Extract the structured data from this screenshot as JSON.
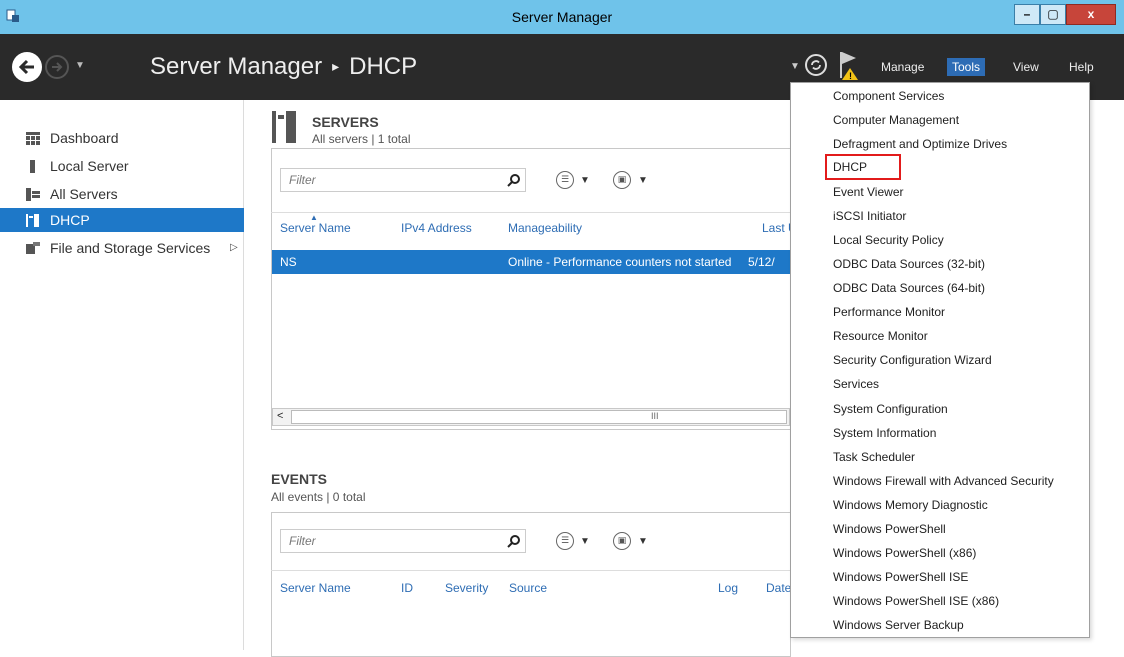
{
  "window": {
    "title": "Server Manager",
    "min_label": "▁",
    "max_label": "▢",
    "close_label": "x"
  },
  "header": {
    "breadcrumb_app": "Server Manager",
    "breadcrumb_sep": "▸",
    "breadcrumb_page": "DHCP",
    "menus": {
      "manage": "Manage",
      "tools": "Tools",
      "view": "View",
      "help": "Help"
    }
  },
  "sidebar": {
    "items": [
      {
        "label": "Dashboard",
        "icon": "dashboard-icon"
      },
      {
        "label": "Local Server",
        "icon": "server-icon"
      },
      {
        "label": "All Servers",
        "icon": "servers-icon"
      },
      {
        "label": "DHCP",
        "icon": "dhcp-icon",
        "active": true
      },
      {
        "label": "File and Storage Services",
        "icon": "storage-icon",
        "arrow": "▷"
      }
    ]
  },
  "servers": {
    "title": "SERVERS",
    "subtitle": "All servers | 1 total",
    "filter_placeholder": "Filter",
    "columns": [
      "Server Name",
      "IPv4 Address",
      "Manageability",
      "Last U"
    ],
    "rows": [
      {
        "name": "NS",
        "ipv4": "",
        "manageability": "Online - Performance counters not started",
        "last": "5/12/"
      }
    ],
    "scroll_mid": "III",
    "scroll_left": "<"
  },
  "events": {
    "title": "EVENTS",
    "subtitle": "All events | 0 total",
    "filter_placeholder": "Filter",
    "columns": [
      "Server Name",
      "ID",
      "Severity",
      "Source",
      "Log",
      "Date"
    ]
  },
  "tools_menu": {
    "items": [
      "Component Services",
      "Computer Management",
      "Defragment and Optimize Drives",
      "DHCP",
      "Event Viewer",
      "iSCSI Initiator",
      "Local Security Policy",
      "ODBC Data Sources (32-bit)",
      "ODBC Data Sources (64-bit)",
      "Performance Monitor",
      "Resource Monitor",
      "Security Configuration Wizard",
      "Services",
      "System Configuration",
      "System Information",
      "Task Scheduler",
      "Windows Firewall with Advanced Security",
      "Windows Memory Diagnostic",
      "Windows PowerShell",
      "Windows PowerShell (x86)",
      "Windows PowerShell ISE",
      "Windows PowerShell ISE (x86)",
      "Windows Server Backup"
    ],
    "highlighted": "DHCP"
  },
  "colors": {
    "titlebar": "#6fc3ea",
    "header": "#2a2a2a",
    "accent": "#1e78c8",
    "highlight_outline": "#e21b1b"
  }
}
